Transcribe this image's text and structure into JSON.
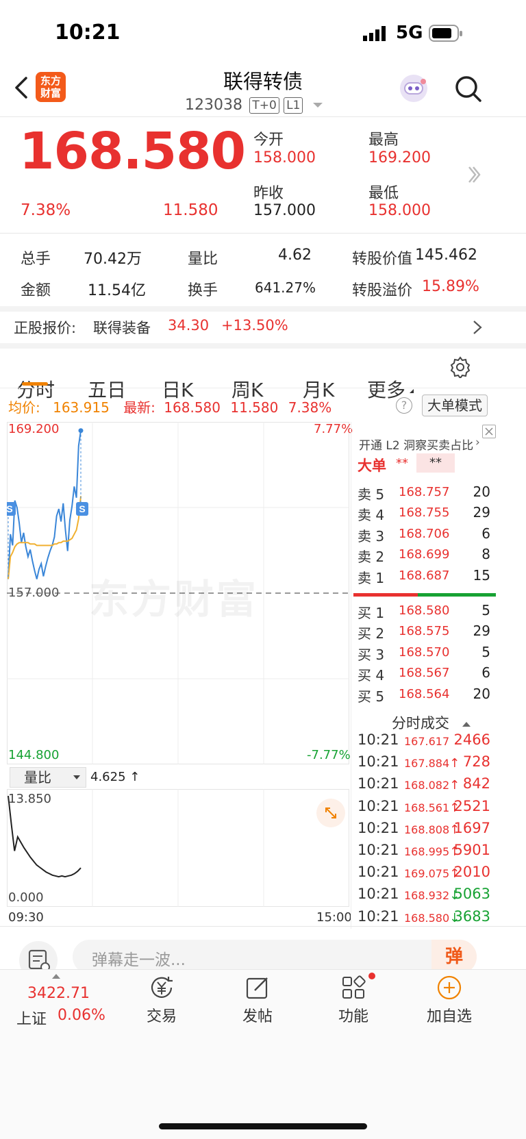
{
  "status_bar": {
    "time": "10:21",
    "network": "5G"
  },
  "header": {
    "logo": "东方\n财富",
    "logo_l1": "东方",
    "logo_l2": "财富",
    "title": "联得转债",
    "code": "123038",
    "badge1": "T+0",
    "badge2": "L1"
  },
  "quote": {
    "price": "168.580",
    "change_pct": "7.38%",
    "change": "11.580",
    "open_label": "今开",
    "open": "158.000",
    "high_label": "最高",
    "high": "169.200",
    "prev_label": "昨收",
    "prev": "157.000",
    "low_label": "最低",
    "low": "158.000"
  },
  "stats": {
    "vol_label": "总手",
    "vol": "70.42万",
    "ratio_label": "量比",
    "ratio": "4.62",
    "conv_label": "转股价值",
    "conv": "145.462",
    "amt_label": "金额",
    "amt": "11.54亿",
    "turn_label": "换手",
    "turn": "641.27%",
    "prem_label": "转股溢价",
    "prem": "15.89%"
  },
  "underlying": {
    "label": "正股报价:",
    "name": "联得装备",
    "price": "34.30",
    "change": "+13.50%"
  },
  "tabs": [
    "分时",
    "五日",
    "日K",
    "周K",
    "月K",
    "更多"
  ],
  "chart_info": {
    "avg_label": "均价:",
    "avg": "163.915",
    "latest_label": "最新:",
    "latest": "168.580",
    "change": "11.580",
    "pct": "7.38%",
    "mode_button": "大单模式"
  },
  "chart_data": {
    "type": "line",
    "y_labels": {
      "top": "169.200",
      "bottom": "144.800",
      "mid": "157.000",
      "top_pct": "7.77%",
      "bottom_pct": "-7.77%"
    },
    "ylim": [
      144.8,
      169.2
    ],
    "x_labels": {
      "start": "09:30",
      "end": "15:00"
    },
    "watermark": "东方财富",
    "series": [
      {
        "values": [
          158.0,
          161.2,
          160.4,
          163.6,
          163.1,
          162.0,
          160.6,
          161.3,
          160.3,
          159.6,
          160.1,
          159.3,
          158.6,
          158.0,
          158.7,
          159.1,
          158.2,
          158.9,
          159.5,
          160.0,
          160.4,
          161.0,
          162.5,
          163.0,
          162.1,
          163.4,
          161.5,
          160.0,
          162.2,
          163.2,
          164.6,
          163.8,
          167.5,
          168.58
        ]
      },
      {
        "values": [
          158.0,
          159.6,
          159.9,
          160.3,
          160.5,
          160.6,
          160.6,
          160.6,
          160.6,
          160.6,
          160.5,
          160.5,
          160.5,
          160.4,
          160.4,
          160.4,
          160.4,
          160.4,
          160.4,
          160.4,
          160.4,
          160.5,
          160.5,
          160.6,
          160.6,
          160.7,
          160.7,
          160.7,
          160.8,
          160.9,
          161.2,
          161.5,
          162.3,
          163.915
        ]
      }
    ]
  },
  "sub_chart": {
    "selector": "量比",
    "value": "4.625 ↑",
    "top": "13.850",
    "bottom": "0.000",
    "values": [
      13.85,
      10.2,
      6.8,
      8.6,
      7.9,
      7.2,
      6.6,
      6.0,
      5.5,
      5.0,
      4.7,
      4.4,
      4.1,
      3.9,
      3.7,
      3.6,
      3.5,
      3.6,
      3.5,
      3.6,
      3.7,
      3.9,
      4.2,
      4.625
    ]
  },
  "order_book": {
    "l2_text": "开通 L2 洞察买卖占比",
    "big_label": "大单",
    "big_v1": "**",
    "big_v2": "**",
    "asks": [
      {
        "label": "卖 5",
        "price": "168.757",
        "vol": "20"
      },
      {
        "label": "卖 4",
        "price": "168.755",
        "vol": "29"
      },
      {
        "label": "卖 3",
        "price": "168.706",
        "vol": "6"
      },
      {
        "label": "卖 2",
        "price": "168.699",
        "vol": "8"
      },
      {
        "label": "卖 1",
        "price": "168.687",
        "vol": "15"
      }
    ],
    "bids": [
      {
        "label": "买 1",
        "price": "168.580",
        "vol": "5"
      },
      {
        "label": "买 2",
        "price": "168.575",
        "vol": "29"
      },
      {
        "label": "买 3",
        "price": "168.570",
        "vol": "5"
      },
      {
        "label": "买 4",
        "price": "168.567",
        "vol": "6"
      },
      {
        "label": "买 5",
        "price": "168.564",
        "vol": "20"
      }
    ],
    "bid_share": 0.45
  },
  "trades": {
    "title": "分时成交",
    "rows": [
      {
        "time": "10:21",
        "price": "167.617",
        "arrow": "",
        "vol": "2466",
        "dir": "up"
      },
      {
        "time": "10:21",
        "price": "167.884",
        "arrow": "↑",
        "vol": "728",
        "dir": "up"
      },
      {
        "time": "10:21",
        "price": "168.082",
        "arrow": "↑",
        "vol": "842",
        "dir": "up"
      },
      {
        "time": "10:21",
        "price": "168.561",
        "arrow": "↑",
        "vol": "2521",
        "dir": "up"
      },
      {
        "time": "10:21",
        "price": "168.808",
        "arrow": "↑",
        "vol": "1697",
        "dir": "up"
      },
      {
        "time": "10:21",
        "price": "168.995",
        "arrow": "↑",
        "vol": "5901",
        "dir": "up"
      },
      {
        "time": "10:21",
        "price": "169.075",
        "arrow": "↑",
        "vol": "2010",
        "dir": "up"
      },
      {
        "time": "10:21",
        "price": "168.932",
        "arrow": "↓",
        "vol": "5063",
        "dir": "down"
      },
      {
        "time": "10:21",
        "price": "168.580",
        "arrow": "↓",
        "vol": "3683",
        "dir": "down"
      }
    ]
  },
  "comment": {
    "placeholder": "弹幕走一波...",
    "send": "弹"
  },
  "bottom_nav": {
    "index_value": "3422.71",
    "index_name": "上证",
    "index_pct": "0.06%",
    "items": [
      {
        "label": "交易"
      },
      {
        "label": "发帖"
      },
      {
        "label": "功能"
      },
      {
        "label": "加自选"
      }
    ]
  }
}
